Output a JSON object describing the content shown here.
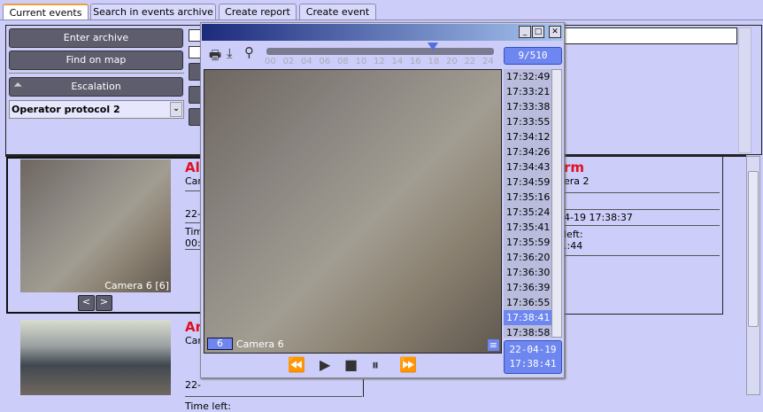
{
  "tabs": [
    {
      "label": "Current events",
      "active": true
    },
    {
      "label": "Search in events archive"
    },
    {
      "label": "Create report"
    },
    {
      "label": "Create event"
    }
  ],
  "left_panel": {
    "enter_archive": "Enter archive",
    "find_on_map": "Find on map",
    "escalation": "Escalation",
    "protocol_value": "Operator protocol 2"
  },
  "events": [
    {
      "title": "Al",
      "camera": "Car",
      "date": "22-",
      "time_left_label": "Tim",
      "time_left": "00:",
      "thumb_caption": "Camera 6 [6]",
      "prev": "<",
      "next": ">"
    },
    {
      "title": "Ar",
      "camera": "Car",
      "date": "22-",
      "time_left_label": "Time left:"
    }
  ],
  "detail": {
    "title": "rm",
    "camera": "era 2",
    "datetime": "4-19 17:38:37",
    "time_left_label": "left:",
    "time_left": ".:44"
  },
  "player": {
    "timeline_ticks": [
      "00",
      "02",
      "04",
      "06",
      "08",
      "10",
      "12",
      "14",
      "16",
      "18",
      "20",
      "22",
      "24"
    ],
    "timeline_position_hour": 17.6,
    "counter": "9/510",
    "times": [
      "17:32:49",
      "17:33:21",
      "17:33:38",
      "17:33:55",
      "17:34:12",
      "17:34:26",
      "17:34:43",
      "17:34:59",
      "17:35:16",
      "17:35:24",
      "17:35:41",
      "17:35:59",
      "17:36:20",
      "17:36:30",
      "17:36:39",
      "17:36:55",
      "17:38:41",
      "17:38:58"
    ],
    "selected_time": "17:38:41",
    "date": "22-04-19",
    "time": "17:38:41",
    "camera_number": "6",
    "camera_name": "Camera 6"
  }
}
